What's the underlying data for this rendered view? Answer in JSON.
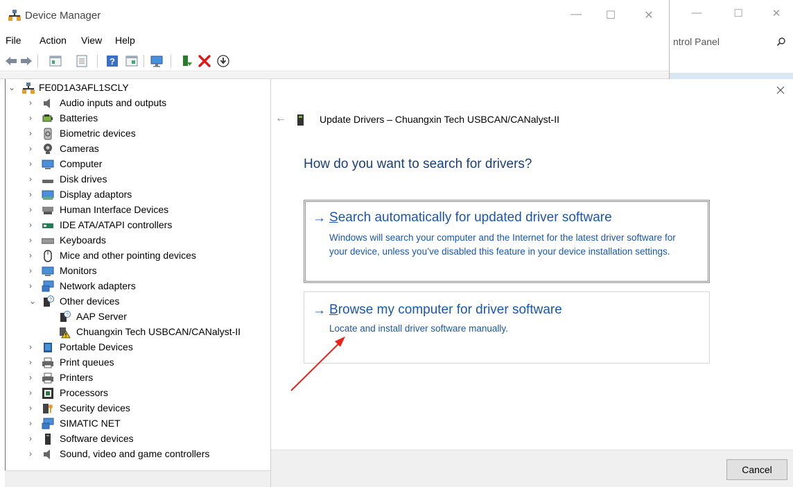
{
  "device_manager": {
    "title": "Device Manager",
    "window_controls": {
      "minimize": "—",
      "maximize": "☐",
      "close": "✕"
    },
    "menu": [
      "File",
      "Action",
      "View",
      "Help"
    ],
    "toolbar_icons": [
      "back-arrow-icon",
      "forward-arrow-icon",
      "properties-icon",
      "view-icon",
      "help-icon",
      "run-icon",
      "monitor-icon",
      "update-driver-icon",
      "uninstall-icon",
      "download-icon"
    ],
    "tree": {
      "root": "FE0D1A3AFL1SCLY",
      "categories": [
        "Audio inputs and outputs",
        "Batteries",
        "Biometric devices",
        "Cameras",
        "Computer",
        "Disk drives",
        "Display adaptors",
        "Human Interface Devices",
        "IDE ATA/ATAPI controllers",
        "Keyboards",
        "Mice and other pointing devices",
        "Monitors",
        "Network adapters",
        "Other devices",
        "AAP Server",
        "Chuangxin Tech USBCAN/CANalyst-II",
        "Portable Devices",
        "Print queues",
        "Printers",
        "Processors",
        "Security devices",
        "SIMATIC NET",
        "Software devices",
        "Sound, video and game controllers"
      ]
    }
  },
  "background_window": {
    "address_text": "ntrol Panel",
    "window_controls": {
      "minimize": "—",
      "maximize": "☐",
      "close": "✕"
    }
  },
  "dialog": {
    "back": "←",
    "header": "Update Drivers – Chuangxin Tech USBCAN/CANalyst-II",
    "heading": "How do you want to search for drivers?",
    "option_auto": {
      "arrow": "→",
      "title": "Search automatically for updated driver software",
      "desc_line1": "Windows will search your computer and the Internet for the latest driver software for",
      "desc_line2": "your device, unless you’ve disabled this feature in your device installation settings."
    },
    "option_browse": {
      "arrow": "→",
      "title": "Browse my computer for driver software",
      "desc": "Locate and install driver software manually."
    },
    "cancel": "Cancel"
  },
  "colors": {
    "link_blue": "#1a56b0",
    "heading_blue": "#1a3f7a",
    "annotation_red": "#e8231a"
  }
}
